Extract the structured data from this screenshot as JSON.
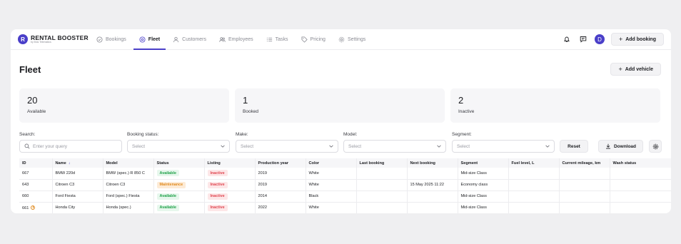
{
  "app": {
    "logo_letter": "R",
    "name": "RENTAL BOOSTER",
    "subtitle": "by Mos Telematics"
  },
  "nav": [
    {
      "label": "Bookings",
      "icon": "check-circle-icon",
      "active": false
    },
    {
      "label": "Fleet",
      "icon": "fleet-icon",
      "active": true
    },
    {
      "label": "Customers",
      "icon": "user-icon",
      "active": false
    },
    {
      "label": "Employees",
      "icon": "users-icon",
      "active": false
    },
    {
      "label": "Tasks",
      "icon": "list-icon",
      "active": false
    },
    {
      "label": "Pricing",
      "icon": "tag-icon",
      "active": false
    },
    {
      "label": "Settings",
      "icon": "gear-icon",
      "active": false
    }
  ],
  "header": {
    "avatar_letter": "D",
    "add_booking_label": "Add booking"
  },
  "page": {
    "title": "Fleet",
    "add_vehicle_label": "Add vehicle"
  },
  "stats": [
    {
      "value": "20",
      "label": "Available"
    },
    {
      "value": "1",
      "label": "Booked"
    },
    {
      "value": "2",
      "label": "Inactive"
    }
  ],
  "filters": {
    "search_label": "Search:",
    "search_placeholder": "Enter your query",
    "booking_status_label": "Booking status:",
    "booking_status_value": "Select",
    "make_label": "Make:",
    "make_value": "Select",
    "model_label": "Model:",
    "model_value": "Select",
    "segment_label": "Segment:",
    "segment_value": "Select",
    "reset_label": "Reset",
    "download_label": "Download"
  },
  "table": {
    "columns": [
      "ID",
      "Name",
      "Model",
      "Status",
      "Listing",
      "Production year",
      "Color",
      "Last booking",
      "Next booking",
      "Segment",
      "Fuel level, L",
      "Current mileage, km",
      "Wash status"
    ],
    "rows": [
      {
        "id": "667",
        "name": "BMW 220d",
        "model": "BMW (spec.) R 850 C",
        "status": "Available",
        "listing": "Inactive",
        "year": "2019",
        "color": "White",
        "last": "",
        "next": "",
        "segment": "Mid-size Class",
        "fuel": "",
        "mileage": "",
        "wash": ""
      },
      {
        "id": "643",
        "name": "Citroen C3",
        "model": "Citroen C3",
        "status": "Maintenance",
        "listing": "Inactive",
        "year": "2019",
        "color": "White",
        "last": "",
        "next": "15 May 2025 11:22",
        "segment": "Economy class",
        "fuel": "",
        "mileage": "",
        "wash": ""
      },
      {
        "id": "660",
        "name": "Ford Fiesta",
        "model": "Ford (spec.) Fiesta",
        "status": "Available",
        "listing": "Inactive",
        "year": "2014",
        "color": "Black",
        "last": "",
        "next": "",
        "segment": "Mid-size Class",
        "fuel": "",
        "mileage": "",
        "wash": ""
      },
      {
        "id": "661",
        "name": "Honda City",
        "model": "Honda (spec.)",
        "status": "Available",
        "listing": "Inactive",
        "year": "2022",
        "color": "White",
        "last": "",
        "next": "",
        "segment": "Mid-size Class",
        "fuel": "",
        "mileage": "",
        "wash": ""
      }
    ]
  },
  "colors": {
    "accent": "#4a3fc9",
    "available": "#21a24a",
    "maintenance": "#e08a1e",
    "inactive": "#e0454f"
  }
}
